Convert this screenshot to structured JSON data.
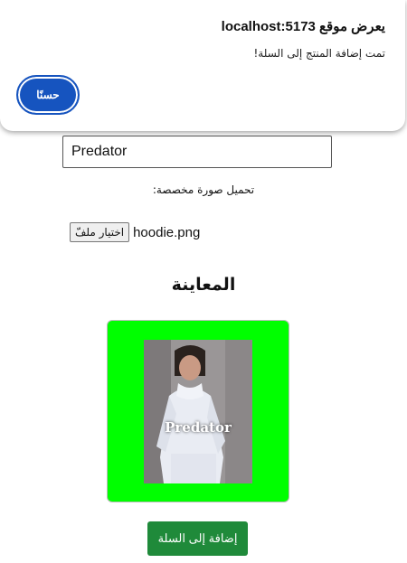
{
  "dialog": {
    "title": "يعرض موقع localhost:5173",
    "message": "تمت إضافة المنتج إلى السلة!",
    "ok_label": "حسنًا"
  },
  "form": {
    "name_value": "Predator",
    "upload_label": ":تحميل صورة مخصصة",
    "file_button_label": "اختيار ملفّ",
    "file_name": "hoodie.png"
  },
  "preview": {
    "heading": "المعاينة",
    "overlay_text": "Predator",
    "background_color": "#00ff00",
    "image_icon": "person-in-white-hoodie-photo"
  },
  "actions": {
    "add_to_cart_label": "إضافة إلى السلة",
    "add_to_cart_color": "#1f8a3a"
  }
}
